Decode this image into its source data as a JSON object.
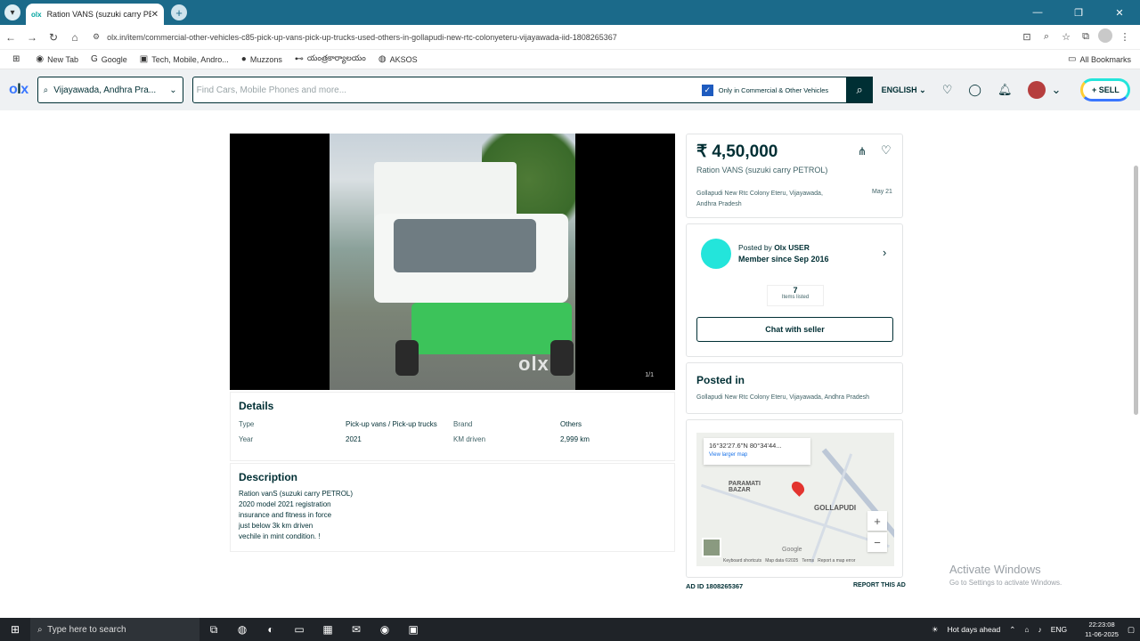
{
  "browser": {
    "tab_title": "Ration VANS (suzuki carry PETROL ...",
    "tab_favicon": "olx",
    "url": "olx.in/item/commercial-other-vehicles-c85-pick-up-vans-pick-up-trucks-used-others-in-gollapudi-new-rtc-colonyeteru-vijayawada-iid-1808265367",
    "bookmarks": [
      "New Tab",
      "Google",
      "Tech, Mobile, Andro...",
      "Muzzons",
      "యంత్రకార్యాలయం",
      "AKSOS"
    ],
    "all_bookmarks": "All Bookmarks"
  },
  "header": {
    "location": "Vijayawada, Andhra Pra...",
    "search_placeholder": "Find Cars, Mobile Phones and more...",
    "filter_checkbox_label": "Only in Commercial & Other Vehicles",
    "language": "ENGLISH",
    "sell_label": "SELL"
  },
  "listing": {
    "image_counter": "1/1",
    "watermark": "olx",
    "price": "₹ 4,50,000",
    "title": "Ration VANS (suzuki carry PETROL)",
    "location_short": "Gollapudi New Rtc Colony Eteru, Vijayawada, Andhra Pradesh",
    "date": "May 21",
    "details_heading": "Details",
    "details": [
      {
        "key": "Type",
        "value": "Pick-up vans / Pick-up trucks"
      },
      {
        "key": "Brand",
        "value": "Others"
      },
      {
        "key": "Year",
        "value": "2021"
      },
      {
        "key": "KM driven",
        "value": "2,999 km"
      }
    ],
    "description_heading": "Description",
    "description_lines": [
      "Ration vanS (suzuki carry PETROL)",
      "2020 model 2021 registration",
      "insurance and fitness in force",
      "just below 3k km driven",
      "vechile in mint condition. !"
    ]
  },
  "seller": {
    "posted_by_label": "Posted by",
    "name": "Olx USER",
    "member_since": "Member since Sep 2016",
    "items_count": "7",
    "items_label": "Items listed",
    "chat_label": "Chat with seller"
  },
  "posted_in": {
    "heading": "Posted in",
    "location": "Gollapudi New Rtc Colony Eteru, Vijayawada, Andhra Pradesh"
  },
  "map": {
    "coords": "16°32'27.6\"N 80°34'44...",
    "view_larger": "View larger map",
    "label_1": "PARAMATI BAZAR",
    "label_2": "GOLLAPUDI",
    "footer": "Keyboard shortcuts   Map data ©2025   Terms   Report a map error",
    "google": "Google"
  },
  "footer": {
    "ad_id": "AD ID 1808265367",
    "report": "REPORT THIS AD",
    "activate_title": "Activate Windows",
    "activate_sub": "Go to Settings to activate Windows."
  },
  "taskbar": {
    "search_placeholder": "Type here to search",
    "weather": "Hot days ahead",
    "lang": "ENG",
    "time": "22:23:08",
    "date": "11-06-2025"
  }
}
